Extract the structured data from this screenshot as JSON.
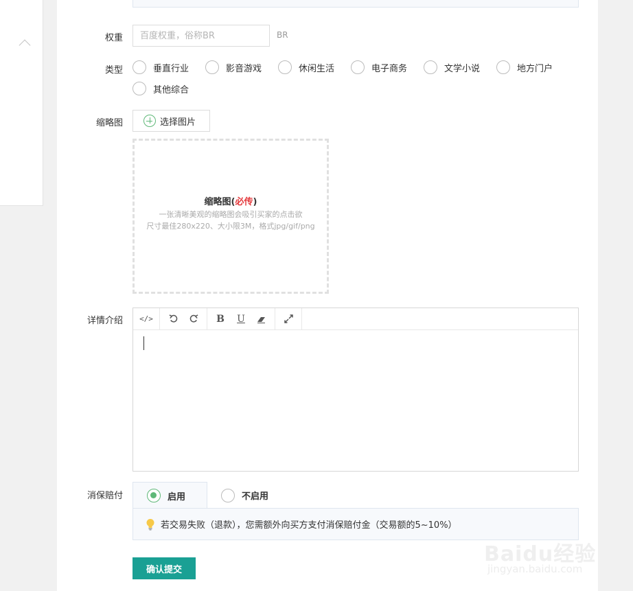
{
  "form": {
    "weight": {
      "label": "权重",
      "placeholder": "百度权重，俗称BR",
      "unit": "BR"
    },
    "type": {
      "label": "类型",
      "options": [
        "垂直行业",
        "影音游戏",
        "休闲生活",
        "电子商务",
        "文学小说",
        "地方门户",
        "其他综合"
      ]
    },
    "thumbnail": {
      "label": "缩略图",
      "select_button": "选择图片",
      "drop_title": "缩略图(",
      "drop_required": "必传",
      "drop_title_end": ")",
      "drop_desc1": "一张清晰美观的缩略图会吸引买家的点击欲",
      "drop_desc2": "尺寸最佳280x220、大小限3M，格式jpg/gif/png"
    },
    "detail": {
      "label": "详情介绍"
    },
    "guarantee": {
      "label": "消保赔付",
      "enable": "启用",
      "disable": "不启用",
      "selected": "启用",
      "notice": "若交易失败（退款），您需额外向买方支付消保赔付金（交易额的5~10%）"
    },
    "submit_label": "确认提交"
  },
  "watermark": {
    "logo": "Baidu经验",
    "url": "jingyan.baidu.com"
  },
  "colors": {
    "accent": "#1aa094",
    "radio_on": "#5fb878",
    "required": "#e4393c"
  }
}
